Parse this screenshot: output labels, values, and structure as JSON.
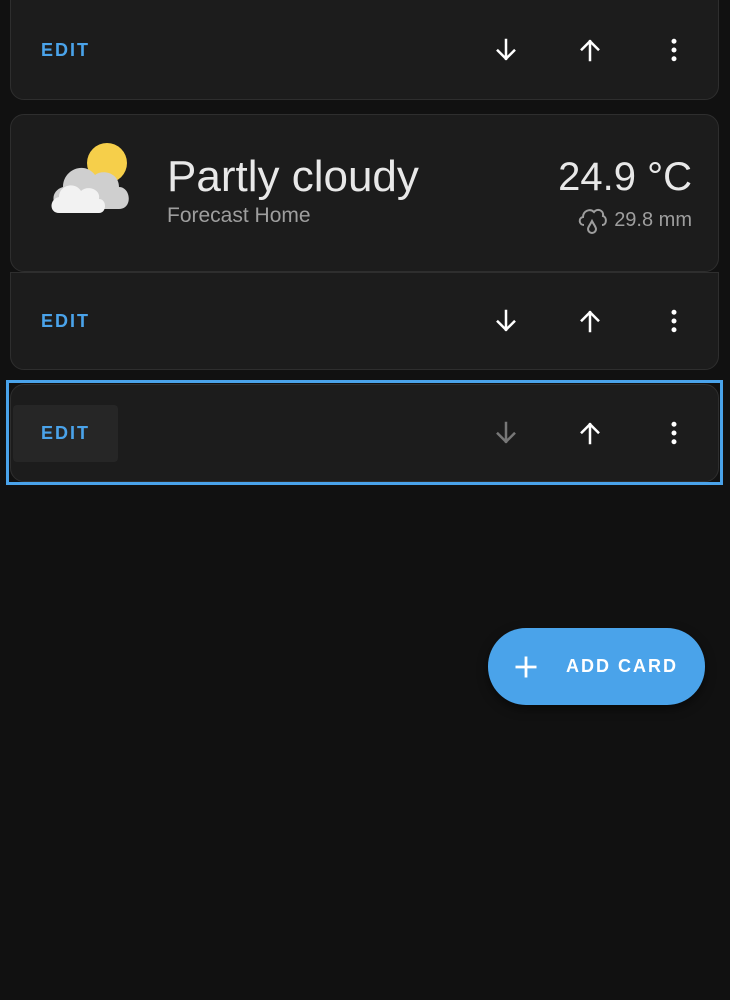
{
  "colors": {
    "background": "#111111",
    "card": "#1c1c1c",
    "accent": "#4aa3ea",
    "primary_text": "#e8e8e8",
    "secondary_text": "#9e9e9e"
  },
  "cards": [
    {
      "type": "editor-bar",
      "edit_label": "EDIT",
      "icons": [
        "arrow-down-icon",
        "arrow-up-icon",
        "more-vertical-icon"
      ]
    },
    {
      "type": "weather",
      "icon": "partly-cloudy-icon",
      "state": "Partly cloudy",
      "name": "Forecast Home",
      "temperature": "24.9 °C",
      "precipitation_icon": "rain-cloud-icon",
      "precipitation": "29.8 mm",
      "edit_label": "EDIT",
      "icons": [
        "arrow-down-icon",
        "arrow-up-icon",
        "more-vertical-icon"
      ]
    },
    {
      "type": "editor-bar",
      "selected": true,
      "edit_label": "EDIT",
      "move_down_disabled": true,
      "icons": [
        "arrow-down-icon",
        "arrow-up-icon",
        "more-vertical-icon"
      ]
    }
  ],
  "fab": {
    "icon": "plus-icon",
    "label": "ADD CARD"
  }
}
